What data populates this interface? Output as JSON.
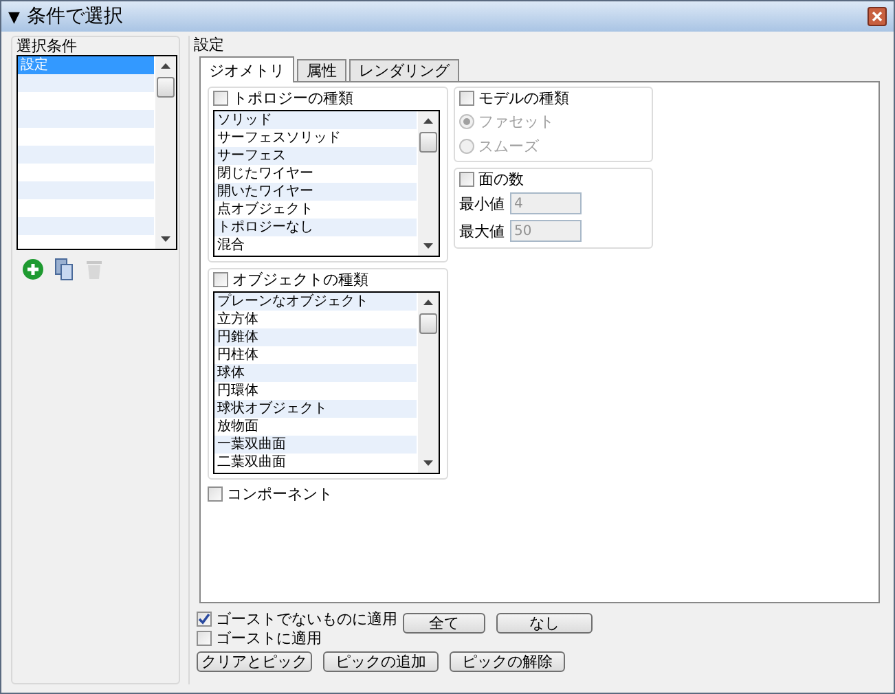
{
  "window": {
    "title": "条件で選択",
    "collapse_glyph": "▼"
  },
  "criteria": {
    "label": "選択条件",
    "items": [
      {
        "label": "設定",
        "selected": true
      }
    ]
  },
  "settings": {
    "label": "設定",
    "tabs": [
      {
        "label": "ジオメトリ",
        "selected": true
      },
      {
        "label": "属性",
        "selected": false
      },
      {
        "label": "レンダリング",
        "selected": false
      }
    ],
    "topology": {
      "label": "トポロジーの種類",
      "checked": false,
      "items": [
        "ソリッド",
        "サーフェスソリッド",
        "サーフェス",
        "閉じたワイヤー",
        "開いたワイヤー",
        "点オブジェクト",
        "トポロジーなし",
        "混合"
      ]
    },
    "model": {
      "label": "モデルの種類",
      "checked": false,
      "options": [
        {
          "label": "ファセット",
          "selected": true
        },
        {
          "label": "スムーズ",
          "selected": false
        }
      ]
    },
    "faces": {
      "label": "面の数",
      "checked": false,
      "fields": [
        {
          "label": "最小値",
          "value": "4"
        },
        {
          "label": "最大値",
          "value": "50"
        }
      ]
    },
    "objects": {
      "label": "オブジェクトの種類",
      "checked": false,
      "items": [
        "プレーンなオブジェクト",
        "立方体",
        "円錐体",
        "円柱体",
        "球体",
        "円環体",
        "球状オブジェクト",
        "放物面",
        "一葉双曲面",
        "二葉双曲面"
      ]
    },
    "component": {
      "label": "コンポーネント",
      "checked": false
    }
  },
  "apply": [
    {
      "label": "ゴーストでないものに適用",
      "checked": true
    },
    {
      "label": "ゴーストに適用",
      "checked": false
    }
  ],
  "select_buttons": [
    "全て",
    "なし"
  ],
  "pick_buttons": [
    "クリアとピック",
    "ピックの追加",
    "ピックの解除"
  ]
}
